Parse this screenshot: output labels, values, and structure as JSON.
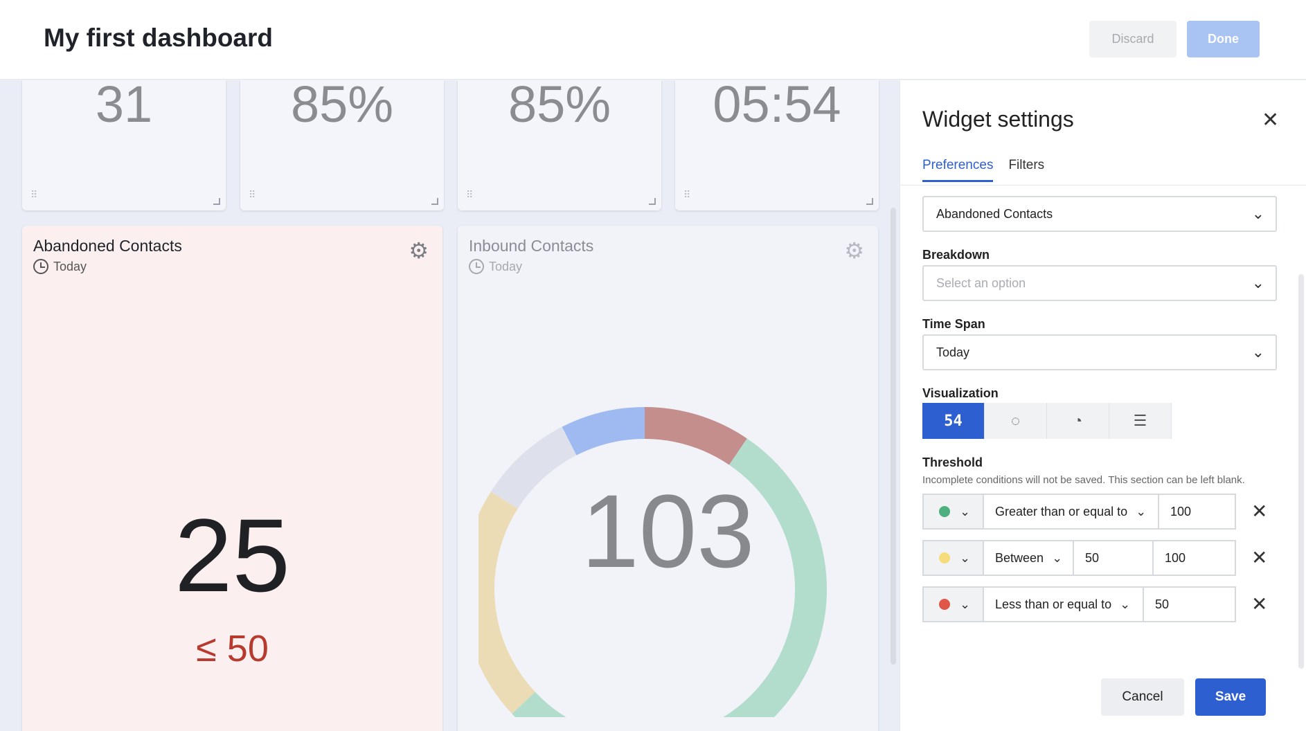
{
  "header": {
    "title": "My first dashboard",
    "discard_label": "Discard",
    "done_label": "Done"
  },
  "kpis": [
    {
      "value": "31"
    },
    {
      "value": "85%"
    },
    {
      "value": "85%"
    },
    {
      "value": "05:54"
    }
  ],
  "cards": {
    "abandoned": {
      "title": "Abandoned Contacts",
      "timespan": "Today",
      "value": "25",
      "threshold": "≤ 50"
    },
    "inbound": {
      "title": "Inbound Contacts",
      "timespan": "Today",
      "value": "103"
    }
  },
  "chart_data": {
    "type": "pie",
    "title": "Inbound Contacts",
    "center_label": "103",
    "slices": [
      {
        "color": "#c48e8c",
        "fraction": 0.095
      },
      {
        "color": "#b2dccb",
        "fraction": 0.535
      },
      {
        "color": "#ecdcb5",
        "fraction": 0.21
      },
      {
        "color": "#dee1ec",
        "fraction": 0.085
      },
      {
        "color": "#9fb9f1",
        "fraction": 0.075
      }
    ]
  },
  "panel": {
    "title": "Widget settings",
    "tabs": [
      {
        "label": "Preferences"
      },
      {
        "label": "Filters"
      }
    ],
    "metric_value": "Abandoned Contacts",
    "breakdown_label": "Breakdown",
    "breakdown_placeholder": "Select an option",
    "timespan_label": "Time Span",
    "timespan_value": "Today",
    "visualization_label": "Visualization",
    "viz_number_glyph": "54",
    "threshold_label": "Threshold",
    "threshold_hint": "Incomplete conditions will not be saved. This section can be left blank.",
    "threshold_rows": [
      {
        "color": "#4fb07f",
        "operator": "Greater than or equal to",
        "value1": "100"
      },
      {
        "color": "#f6dc7a",
        "operator": "Between",
        "value1": "50",
        "value2": "100"
      },
      {
        "color": "#e0574a",
        "operator": "Less than or equal to",
        "value1": "50"
      }
    ],
    "cancel_label": "Cancel",
    "save_label": "Save"
  }
}
